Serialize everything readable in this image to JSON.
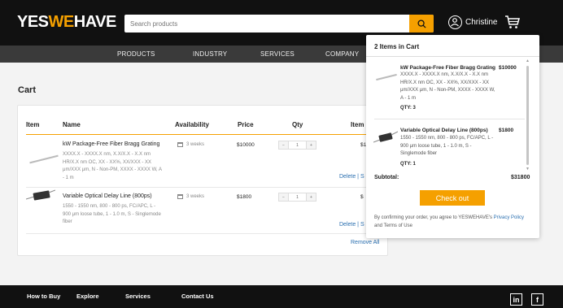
{
  "header": {
    "logo_prefix": "YES",
    "logo_accent": "WE",
    "logo_suffix": "HAVE",
    "search_placeholder": "Search products",
    "user_name": "Christine"
  },
  "nav": {
    "items": [
      "PRODUCTS",
      "INDUSTRY",
      "SERVICES",
      "COMPANY"
    ]
  },
  "cart": {
    "title": "Cart",
    "columns": [
      "Item",
      "Name",
      "Availability",
      "Price",
      "Qty",
      "Item"
    ],
    "rows": [
      {
        "name": "kW Package-Free Fiber Bragg Grating",
        "description": "XXXX.X - XXXX.X nm, X.X/X.X - X.X nm HR/X.X nm OC, XX - XX%, XX/XXX - XX μm/XXX μm, N - Non-PM, XXXX - XXXX W, A - 1 m",
        "availability": "3 weeks",
        "price": "$10000",
        "qty": "1",
        "total": "$1",
        "delete": "Delete",
        "save": "S"
      },
      {
        "name": "Variable Optical Delay Line (800ps)",
        "description": "1550 - 1550 nm, 800 - 800 ps, FC/APC, L - 900 μm loose tube, 1 - 1.0 m, S - Singlemode fiber",
        "availability": "3 weeks",
        "price": "$1800",
        "qty": "1",
        "total": "$",
        "delete": "Delete",
        "save": "S"
      }
    ],
    "remove_all": "Remove All"
  },
  "popup": {
    "title": "2 Items in Cart",
    "items": [
      {
        "name": "kW Package-Free Fiber Bragg Grating",
        "description": "XXXX.X - XXXX.X nm, X.X/X.X - X.X nm HR/X.X nm OC, XX - XX%, XX/XXX - XX μm/XXX μm, N - Non-PM, XXXX - XXXX W, A - 1 m",
        "price": "$10000",
        "qty": "QTY: 3"
      },
      {
        "name": "Variable Optical Delay Line (800ps)",
        "description": "1550 - 1550 nm, 800 - 800 ps, FC/APC, L - 900 μm loose tube, 1 - 1.0 m, S - Singlemode fiber",
        "price": "$1800",
        "qty": "QTY: 1"
      }
    ],
    "subtotal_label": "Subtotal:",
    "subtotal_value": "$31800",
    "checkout_label": "Check out",
    "terms_prefix": "By confirming your order, you agree to YESWEHAVE's ",
    "terms_link1": "Privacy Policy",
    "terms_mid": " and Terms of Use"
  },
  "footer": {
    "links": [
      "How to Buy",
      "Explore",
      "Services",
      "Contact Us"
    ],
    "social": [
      "in",
      "f"
    ]
  },
  "colors": {
    "accent": "#f5a000",
    "link": "#2a6fb0",
    "header_bg": "#111111",
    "nav_bg": "#3a3a3a"
  }
}
